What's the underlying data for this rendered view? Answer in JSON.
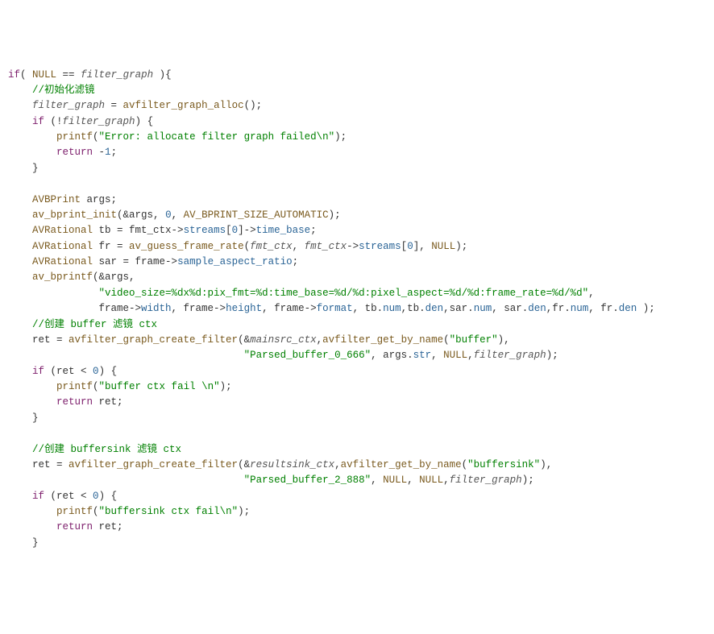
{
  "code": {
    "lines": [
      [
        {
          "cls": "tok-kw",
          "t": "if"
        },
        {
          "cls": "",
          "t": "( "
        },
        {
          "cls": "tok-fn",
          "t": "NULL"
        },
        {
          "cls": "",
          "t": " == "
        },
        {
          "cls": "tok-it",
          "t": "filter_graph"
        },
        {
          "cls": "",
          "t": " ){"
        }
      ],
      [
        {
          "cls": "",
          "t": "    "
        },
        {
          "cls": "tok-cm",
          "t": "//初始化滤镜"
        }
      ],
      [
        {
          "cls": "",
          "t": "    "
        },
        {
          "cls": "tok-it",
          "t": "filter_graph"
        },
        {
          "cls": "",
          "t": " = "
        },
        {
          "cls": "tok-fn",
          "t": "avfilter_graph_alloc"
        },
        {
          "cls": "",
          "t": "();"
        }
      ],
      [
        {
          "cls": "",
          "t": "    "
        },
        {
          "cls": "tok-kw",
          "t": "if"
        },
        {
          "cls": "",
          "t": " (!"
        },
        {
          "cls": "tok-it",
          "t": "filter_graph"
        },
        {
          "cls": "",
          "t": ") {"
        }
      ],
      [
        {
          "cls": "",
          "t": "        "
        },
        {
          "cls": "tok-fn",
          "t": "printf"
        },
        {
          "cls": "",
          "t": "("
        },
        {
          "cls": "tok-str",
          "t": "\"Error: allocate filter graph failed\\n\""
        },
        {
          "cls": "",
          "t": ");"
        }
      ],
      [
        {
          "cls": "",
          "t": "        "
        },
        {
          "cls": "tok-kw",
          "t": "return"
        },
        {
          "cls": "",
          "t": " -"
        },
        {
          "cls": "tok-num",
          "t": "1"
        },
        {
          "cls": "",
          "t": ";"
        }
      ],
      [
        {
          "cls": "",
          "t": "    }"
        }
      ],
      [
        {
          "cls": "",
          "t": " "
        }
      ],
      [
        {
          "cls": "",
          "t": "    "
        },
        {
          "cls": "tok-fn",
          "t": "AVBPrint"
        },
        {
          "cls": "",
          "t": " args;"
        }
      ],
      [
        {
          "cls": "",
          "t": "    "
        },
        {
          "cls": "tok-fn",
          "t": "av_bprint_init"
        },
        {
          "cls": "",
          "t": "(&args, "
        },
        {
          "cls": "tok-num",
          "t": "0"
        },
        {
          "cls": "",
          "t": ", "
        },
        {
          "cls": "tok-fn",
          "t": "AV_BPRINT_SIZE_AUTOMATIC"
        },
        {
          "cls": "",
          "t": ");"
        }
      ],
      [
        {
          "cls": "",
          "t": "    "
        },
        {
          "cls": "tok-fn",
          "t": "AVRational"
        },
        {
          "cls": "",
          "t": " tb = fmt_ctx->"
        },
        {
          "cls": "tok-mem",
          "t": "streams"
        },
        {
          "cls": "",
          "t": "["
        },
        {
          "cls": "tok-num",
          "t": "0"
        },
        {
          "cls": "",
          "t": "]->"
        },
        {
          "cls": "tok-mem",
          "t": "time_base"
        },
        {
          "cls": "",
          "t": ";"
        }
      ],
      [
        {
          "cls": "",
          "t": "    "
        },
        {
          "cls": "tok-fn",
          "t": "AVRational"
        },
        {
          "cls": "",
          "t": " fr = "
        },
        {
          "cls": "tok-fn",
          "t": "av_guess_frame_rate"
        },
        {
          "cls": "",
          "t": "("
        },
        {
          "cls": "tok-it",
          "t": "fmt_ctx"
        },
        {
          "cls": "",
          "t": ", "
        },
        {
          "cls": "tok-it",
          "t": "fmt_ctx"
        },
        {
          "cls": "",
          "t": "->"
        },
        {
          "cls": "tok-mem",
          "t": "streams"
        },
        {
          "cls": "",
          "t": "["
        },
        {
          "cls": "tok-num",
          "t": "0"
        },
        {
          "cls": "",
          "t": "], "
        },
        {
          "cls": "tok-fn",
          "t": "NULL"
        },
        {
          "cls": "",
          "t": ");"
        }
      ],
      [
        {
          "cls": "",
          "t": "    "
        },
        {
          "cls": "tok-fn",
          "t": "AVRational"
        },
        {
          "cls": "",
          "t": " sar = frame->"
        },
        {
          "cls": "tok-mem",
          "t": "sample_aspect_ratio"
        },
        {
          "cls": "",
          "t": ";"
        }
      ],
      [
        {
          "cls": "",
          "t": "    "
        },
        {
          "cls": "tok-fn",
          "t": "av_bprintf"
        },
        {
          "cls": "",
          "t": "(&args,"
        }
      ],
      [
        {
          "cls": "",
          "t": "               "
        },
        {
          "cls": "tok-str",
          "t": "\"video_size=%dx%d:pix_fmt=%d:time_base=%d/%d:pixel_aspect=%d/%d:frame_rate=%d/%d\""
        },
        {
          "cls": "",
          "t": ","
        }
      ],
      [
        {
          "cls": "",
          "t": "               frame->"
        },
        {
          "cls": "tok-mem",
          "t": "width"
        },
        {
          "cls": "",
          "t": ", frame->"
        },
        {
          "cls": "tok-mem",
          "t": "height"
        },
        {
          "cls": "",
          "t": ", frame->"
        },
        {
          "cls": "tok-mem",
          "t": "format"
        },
        {
          "cls": "",
          "t": ", tb."
        },
        {
          "cls": "tok-mem",
          "t": "num"
        },
        {
          "cls": "",
          "t": ",tb."
        },
        {
          "cls": "tok-mem",
          "t": "den"
        },
        {
          "cls": "",
          "t": ",sar."
        },
        {
          "cls": "tok-mem",
          "t": "num"
        },
        {
          "cls": "",
          "t": ", sar."
        },
        {
          "cls": "tok-mem",
          "t": "den"
        },
        {
          "cls": "",
          "t": ",fr."
        },
        {
          "cls": "tok-mem",
          "t": "num"
        },
        {
          "cls": "",
          "t": ", fr."
        },
        {
          "cls": "tok-mem",
          "t": "den"
        },
        {
          "cls": "",
          "t": " );"
        }
      ],
      [
        {
          "cls": "",
          "t": "    "
        },
        {
          "cls": "tok-cm",
          "t": "//创建 buffer 滤镜 ctx"
        }
      ],
      [
        {
          "cls": "",
          "t": "    ret = "
        },
        {
          "cls": "tok-fn",
          "t": "avfilter_graph_create_filter"
        },
        {
          "cls": "",
          "t": "(&"
        },
        {
          "cls": "tok-it",
          "t": "mainsrc_ctx"
        },
        {
          "cls": "",
          "t": ","
        },
        {
          "cls": "tok-fn",
          "t": "avfilter_get_by_name"
        },
        {
          "cls": "",
          "t": "("
        },
        {
          "cls": "tok-str",
          "t": "\"buffer\""
        },
        {
          "cls": "",
          "t": "),"
        }
      ],
      [
        {
          "cls": "",
          "t": "                                       "
        },
        {
          "cls": "tok-str",
          "t": "\"Parsed_buffer_0_666\""
        },
        {
          "cls": "",
          "t": ", args."
        },
        {
          "cls": "tok-mem",
          "t": "str"
        },
        {
          "cls": "",
          "t": ", "
        },
        {
          "cls": "tok-fn",
          "t": "NULL"
        },
        {
          "cls": "",
          "t": ","
        },
        {
          "cls": "tok-it",
          "t": "filter_graph"
        },
        {
          "cls": "",
          "t": ");"
        }
      ],
      [
        {
          "cls": "",
          "t": "    "
        },
        {
          "cls": "tok-kw",
          "t": "if"
        },
        {
          "cls": "",
          "t": " (ret < "
        },
        {
          "cls": "tok-num",
          "t": "0"
        },
        {
          "cls": "",
          "t": ") {"
        }
      ],
      [
        {
          "cls": "",
          "t": "        "
        },
        {
          "cls": "tok-fn",
          "t": "printf"
        },
        {
          "cls": "",
          "t": "("
        },
        {
          "cls": "tok-str",
          "t": "\"buffer ctx fail \\n\""
        },
        {
          "cls": "",
          "t": ");"
        }
      ],
      [
        {
          "cls": "",
          "t": "        "
        },
        {
          "cls": "tok-kw",
          "t": "return"
        },
        {
          "cls": "",
          "t": " ret;"
        }
      ],
      [
        {
          "cls": "",
          "t": "    }"
        }
      ],
      [
        {
          "cls": "",
          "t": " "
        }
      ],
      [
        {
          "cls": "",
          "t": "    "
        },
        {
          "cls": "tok-cm",
          "t": "//创建 buffersink 滤镜 ctx"
        }
      ],
      [
        {
          "cls": "",
          "t": "    ret = "
        },
        {
          "cls": "tok-fn",
          "t": "avfilter_graph_create_filter"
        },
        {
          "cls": "",
          "t": "(&"
        },
        {
          "cls": "tok-it",
          "t": "resultsink_ctx"
        },
        {
          "cls": "",
          "t": ","
        },
        {
          "cls": "tok-fn",
          "t": "avfilter_get_by_name"
        },
        {
          "cls": "",
          "t": "("
        },
        {
          "cls": "tok-str",
          "t": "\"buffersink\""
        },
        {
          "cls": "",
          "t": "),"
        }
      ],
      [
        {
          "cls": "",
          "t": "                                       "
        },
        {
          "cls": "tok-str",
          "t": "\"Parsed_buffer_2_888\""
        },
        {
          "cls": "",
          "t": ", "
        },
        {
          "cls": "tok-fn",
          "t": "NULL"
        },
        {
          "cls": "",
          "t": ", "
        },
        {
          "cls": "tok-fn",
          "t": "NULL"
        },
        {
          "cls": "",
          "t": ","
        },
        {
          "cls": "tok-it",
          "t": "filter_graph"
        },
        {
          "cls": "",
          "t": ");"
        }
      ],
      [
        {
          "cls": "",
          "t": "    "
        },
        {
          "cls": "tok-kw",
          "t": "if"
        },
        {
          "cls": "",
          "t": " (ret < "
        },
        {
          "cls": "tok-num",
          "t": "0"
        },
        {
          "cls": "",
          "t": ") {"
        }
      ],
      [
        {
          "cls": "",
          "t": "        "
        },
        {
          "cls": "tok-fn",
          "t": "printf"
        },
        {
          "cls": "",
          "t": "("
        },
        {
          "cls": "tok-str",
          "t": "\"buffersink ctx fail\\n\""
        },
        {
          "cls": "",
          "t": ");"
        }
      ],
      [
        {
          "cls": "",
          "t": "        "
        },
        {
          "cls": "tok-kw",
          "t": "return"
        },
        {
          "cls": "",
          "t": " ret;"
        }
      ],
      [
        {
          "cls": "",
          "t": "    }"
        }
      ]
    ]
  }
}
